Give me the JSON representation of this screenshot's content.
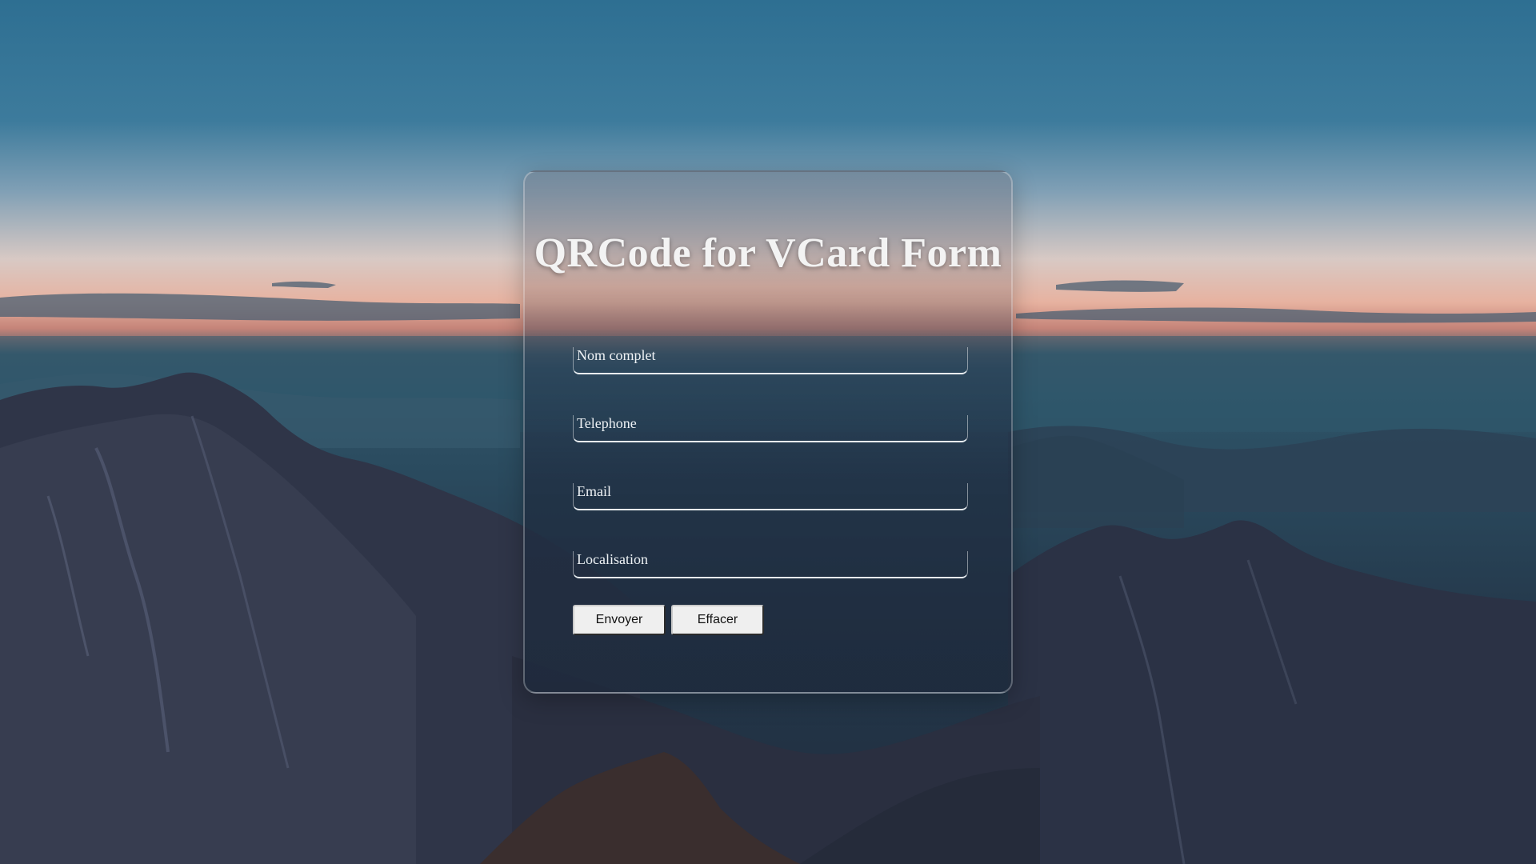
{
  "form": {
    "title": "QRCode for VCard Form",
    "fields": [
      {
        "label": "Nom complet",
        "value": ""
      },
      {
        "label": "Telephone",
        "value": ""
      },
      {
        "label": "Email",
        "value": ""
      },
      {
        "label": "Localisation",
        "value": ""
      }
    ],
    "buttons": {
      "submit_label": "Envoyer",
      "reset_label": "Effacer"
    }
  },
  "colors": {
    "field_underline": "#e9eef2",
    "title_text": "#f3f3f3",
    "button_bg": "#efefef"
  }
}
